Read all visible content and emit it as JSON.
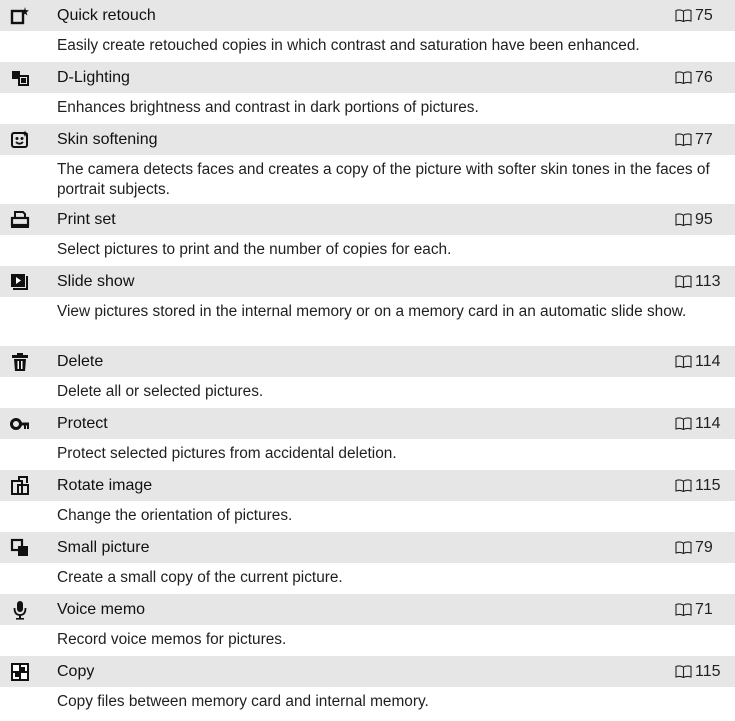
{
  "colors": {
    "header_band": "#e6e6e6",
    "text": "#1a1a1a",
    "icon": "#111111"
  },
  "entries": [
    {
      "icon": "quick-retouch-icon",
      "title": "Quick retouch",
      "page": "75",
      "description": "Easily create retouched copies in which contrast and saturation have been enhanced."
    },
    {
      "icon": "d-lighting-icon",
      "title": "D-Lighting",
      "page": "76",
      "description": "Enhances brightness and contrast in dark portions of pictures."
    },
    {
      "icon": "skin-softening-icon",
      "title": "Skin softening",
      "page": "77",
      "description": "The camera detects faces and creates a copy of the picture with softer skin tones in the faces of portrait subjects."
    },
    {
      "icon": "print-set-icon",
      "title": "Print set",
      "page": "95",
      "description": "Select pictures to print and the number of copies for each."
    },
    {
      "icon": "slide-show-icon",
      "title": "Slide show",
      "page": "113",
      "description": "View pictures stored in the internal memory or on a memory card in an automatic slide show."
    },
    {
      "icon": "delete-icon",
      "title": "Delete",
      "page": "114",
      "description": "Delete all or selected pictures."
    },
    {
      "icon": "protect-icon",
      "title": "Protect",
      "page": "114",
      "description": "Protect selected pictures from accidental deletion."
    },
    {
      "icon": "rotate-image-icon",
      "title": "Rotate image",
      "page": "115",
      "description": "Change the orientation of pictures."
    },
    {
      "icon": "small-picture-icon",
      "title": "Small picture",
      "page": "79",
      "description": "Create a small copy of the current picture."
    },
    {
      "icon": "voice-memo-icon",
      "title": "Voice memo",
      "page": "71",
      "description": "Record voice memos for pictures."
    },
    {
      "icon": "copy-icon",
      "title": "Copy",
      "page": "115",
      "description": "Copy files between memory card and internal memory."
    }
  ]
}
